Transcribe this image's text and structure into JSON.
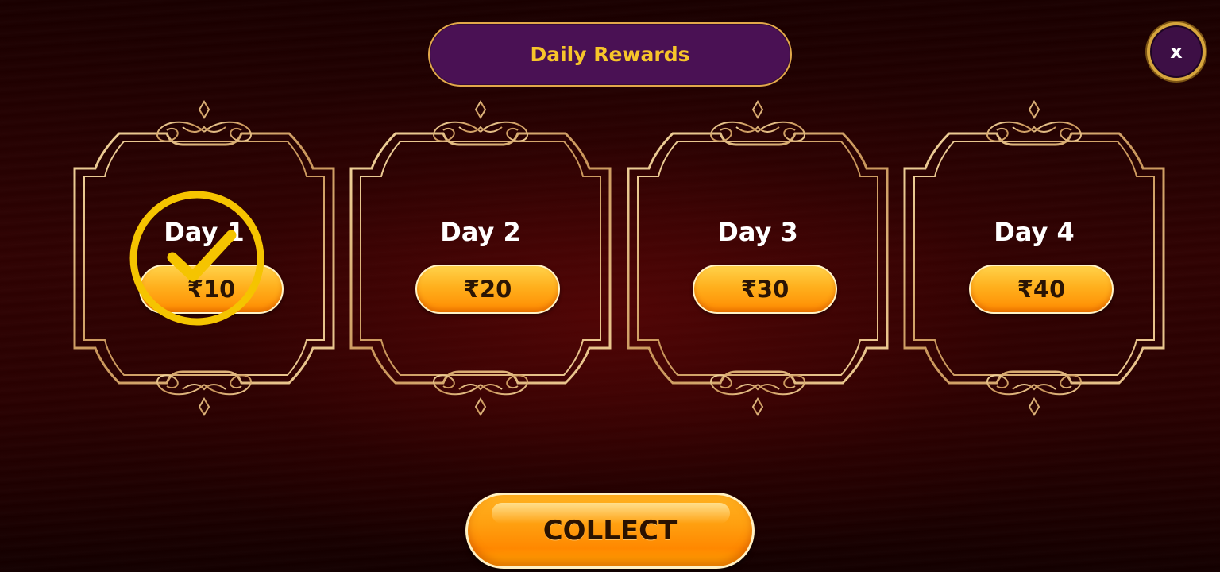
{
  "header": {
    "title": "Daily Rewards"
  },
  "close_button": {
    "label": "x"
  },
  "days": [
    {
      "label": "Day 1",
      "amount": "₹10",
      "collected": true
    },
    {
      "label": "Day 2",
      "amount": "₹20",
      "collected": false
    },
    {
      "label": "Day 3",
      "amount": "₹30",
      "collected": false
    },
    {
      "label": "Day 4",
      "amount": "₹40",
      "collected": false
    }
  ],
  "collect_button": {
    "label": "COLLECT"
  },
  "colors": {
    "title_bg": "#4a1154",
    "title_text": "#f7c52a",
    "gold": "#e2a84a",
    "button_orange": "#ffa010",
    "check_yellow": "#f5c400"
  }
}
